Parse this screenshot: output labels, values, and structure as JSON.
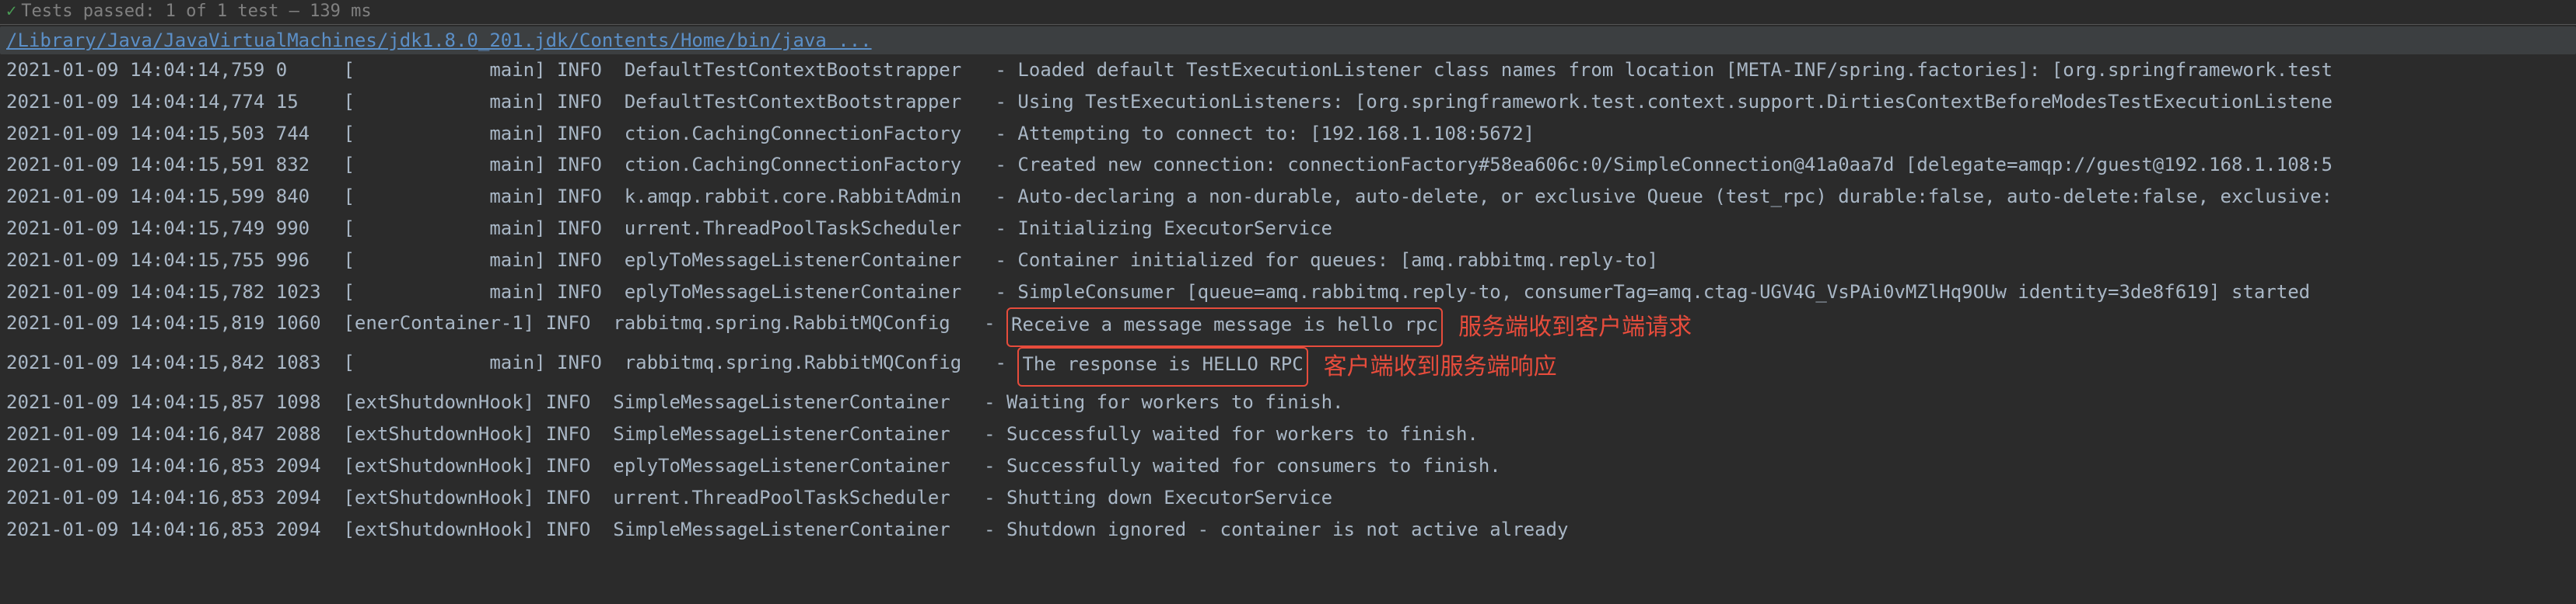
{
  "header": {
    "test_status": "Tests passed: 1 of 1 test – 139 ms"
  },
  "command": {
    "path": "/Library/Java/JavaVirtualMachines/jdk1.8.0_201.jdk/Contents/Home/bin/java ..."
  },
  "logs": [
    {
      "timestamp": "2021-01-09 14:04:14,759",
      "offset": "0",
      "thread": "[            main]",
      "level": "INFO",
      "logger": "DefaultTestContextBootstrapper",
      "message": "- Loaded default TestExecutionListener class names from location [META-INF/spring.factories]: [org.springframework.test"
    },
    {
      "timestamp": "2021-01-09 14:04:14,774",
      "offset": "15",
      "thread": "[            main]",
      "level": "INFO",
      "logger": "DefaultTestContextBootstrapper",
      "message": "- Using TestExecutionListeners: [org.springframework.test.context.support.DirtiesContextBeforeModesTestExecutionListene"
    },
    {
      "timestamp": "2021-01-09 14:04:15,503",
      "offset": "744",
      "thread": "[            main]",
      "level": "INFO",
      "logger": "ction.CachingConnectionFactory",
      "message": "- Attempting to connect to: [192.168.1.108:5672]"
    },
    {
      "timestamp": "2021-01-09 14:04:15,591",
      "offset": "832",
      "thread": "[            main]",
      "level": "INFO",
      "logger": "ction.CachingConnectionFactory",
      "message": "- Created new connection: connectionFactory#58ea606c:0/SimpleConnection@41a0aa7d [delegate=amqp://guest@192.168.1.108:5"
    },
    {
      "timestamp": "2021-01-09 14:04:15,599",
      "offset": "840",
      "thread": "[            main]",
      "level": "INFO",
      "logger": "k.amqp.rabbit.core.RabbitAdmin",
      "message": "- Auto-declaring a non-durable, auto-delete, or exclusive Queue (test_rpc) durable:false, auto-delete:false, exclusive:"
    },
    {
      "timestamp": "2021-01-09 14:04:15,749",
      "offset": "990",
      "thread": "[            main]",
      "level": "INFO",
      "logger": "urrent.ThreadPoolTaskScheduler",
      "message": "- Initializing ExecutorService"
    },
    {
      "timestamp": "2021-01-09 14:04:15,755",
      "offset": "996",
      "thread": "[            main]",
      "level": "INFO",
      "logger": "eplyToMessageListenerContainer",
      "message": "- Container initialized for queues: [amq.rabbitmq.reply-to]"
    },
    {
      "timestamp": "2021-01-09 14:04:15,782",
      "offset": "1023",
      "thread": "[            main]",
      "level": "INFO",
      "logger": "eplyToMessageListenerContainer",
      "message": "- SimpleConsumer [queue=amq.rabbitmq.reply-to, consumerTag=amq.ctag-UGV4G_VsPAi0vMZlHq9OUw identity=3de8f619] started"
    },
    {
      "timestamp": "2021-01-09 14:04:15,819",
      "offset": "1060",
      "thread": "[enerContainer-1]",
      "level": "INFO",
      "logger": "rabbitmq.spring.RabbitMQConfig",
      "message_prefix": "- ",
      "highlighted": "Receive a message message is hello rpc",
      "annotation": "服务端收到客户端请求"
    },
    {
      "timestamp": "2021-01-09 14:04:15,842",
      "offset": "1083",
      "thread": "[            main]",
      "level": "INFO",
      "logger": "rabbitmq.spring.RabbitMQConfig",
      "message_prefix": "- ",
      "highlighted": "The response is HELLO RPC",
      "annotation": "客户端收到服务端响应"
    },
    {
      "timestamp": "2021-01-09 14:04:15,857",
      "offset": "1098",
      "thread": "[extShutdownHook]",
      "level": "INFO",
      "logger": "SimpleMessageListenerContainer",
      "message": "- Waiting for workers to finish."
    },
    {
      "timestamp": "2021-01-09 14:04:16,847",
      "offset": "2088",
      "thread": "[extShutdownHook]",
      "level": "INFO",
      "logger": "SimpleMessageListenerContainer",
      "message": "- Successfully waited for workers to finish."
    },
    {
      "timestamp": "2021-01-09 14:04:16,853",
      "offset": "2094",
      "thread": "[extShutdownHook]",
      "level": "INFO",
      "logger": "eplyToMessageListenerContainer",
      "message": "- Successfully waited for consumers to finish."
    },
    {
      "timestamp": "2021-01-09 14:04:16,853",
      "offset": "2094",
      "thread": "[extShutdownHook]",
      "level": "INFO",
      "logger": "urrent.ThreadPoolTaskScheduler",
      "message": "- Shutting down ExecutorService"
    },
    {
      "timestamp": "2021-01-09 14:04:16,853",
      "offset": "2094",
      "thread": "[extShutdownHook]",
      "level": "INFO",
      "logger": "SimpleMessageListenerContainer",
      "message": "- Shutdown ignored - container is not active already"
    }
  ]
}
